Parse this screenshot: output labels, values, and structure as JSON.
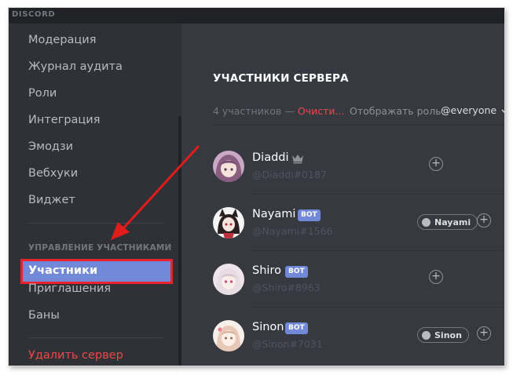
{
  "app": {
    "logo": "DISCORD"
  },
  "sidebar": {
    "items": [
      {
        "label": "Модерация"
      },
      {
        "label": "Журнал аудита"
      },
      {
        "label": "Роли"
      },
      {
        "label": "Интеграция"
      },
      {
        "label": "Эмодзи"
      },
      {
        "label": "Вебхуки"
      },
      {
        "label": "Виджет"
      }
    ],
    "section_header": "УПРАВЛЕНИЕ УЧАСТНИКАМИ",
    "active_item": "Участники",
    "member_items": [
      {
        "label": "Приглашения"
      },
      {
        "label": "Баны"
      }
    ],
    "delete_server": "Удалить сервер"
  },
  "main": {
    "title": "УЧАСТНИКИ СЕРВЕРА",
    "member_count": "4 участников —",
    "prune_label": "Очисти...",
    "display_roles_label": "Отображать роль:",
    "role_filter": "@everyone",
    "members": [
      {
        "name": "Diaddi",
        "tag": "@Diaddi#0187",
        "owner": true,
        "bot": false,
        "role": null
      },
      {
        "name": "Nayami",
        "tag": "@Nayami#1566",
        "owner": false,
        "bot": true,
        "bot_label": "BOT",
        "role": "Nayami"
      },
      {
        "name": "Shiro",
        "tag": "@Shiro#8963",
        "owner": false,
        "bot": true,
        "bot_label": "BOT",
        "role": null
      },
      {
        "name": "Sinon",
        "tag": "@Sinon#7031",
        "owner": false,
        "bot": true,
        "bot_label": "BOT",
        "role": "Sinon"
      }
    ],
    "add_role_glyph": "+"
  },
  "colors": {
    "accent": "#7289da",
    "danger": "#f04747",
    "highlight_outline": "#e8232b",
    "background": "#36393f",
    "sidebar": "#2f3136"
  },
  "icons": [
    "crown-icon",
    "chevron-down-icon",
    "plus-icon",
    "annotation-arrow"
  ]
}
